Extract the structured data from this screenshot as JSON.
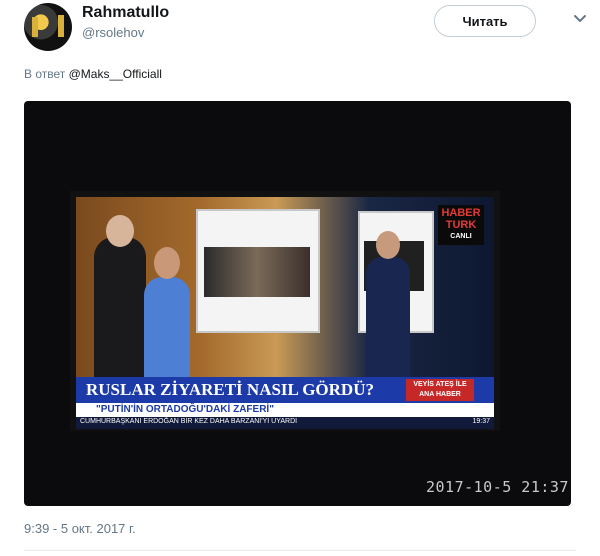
{
  "author": {
    "name": "Rahmatullo",
    "handle": "@rsolehov"
  },
  "follow_button": {
    "label": "Читать"
  },
  "reply": {
    "prefix": "В ответ",
    "mention": "@Maks__Officiall"
  },
  "media": {
    "tv_logo_line1": "HABER",
    "tv_logo_line2": "TURK",
    "tv_logo_live": "CANLI",
    "banner_title": "RUSLAR ZİYARETİ NASIL GÖRDÜ?",
    "banner_subtitle": "\"PUTİN'İN ORTADOĞU'DAKİ ZAFERİ\"",
    "program_tag": "VEYİS ATEŞ İLE ANA HABER",
    "ticker": "CUMHURBAŞKANI ERDOĞAN BİR KEZ DAHA BARZANİ'Yİ UYARDI",
    "tv_clock": "19:37",
    "date_stamp": "2017-10-5 21:37"
  },
  "timestamp": "9:39 - 5 окт. 2017 г.",
  "icons": {
    "avatar": "user-avatar",
    "menu": "chevron-down-icon"
  },
  "colors": {
    "banner": "#1c3aa8",
    "accent_red": "#c62828",
    "muted_text": "#657786"
  }
}
